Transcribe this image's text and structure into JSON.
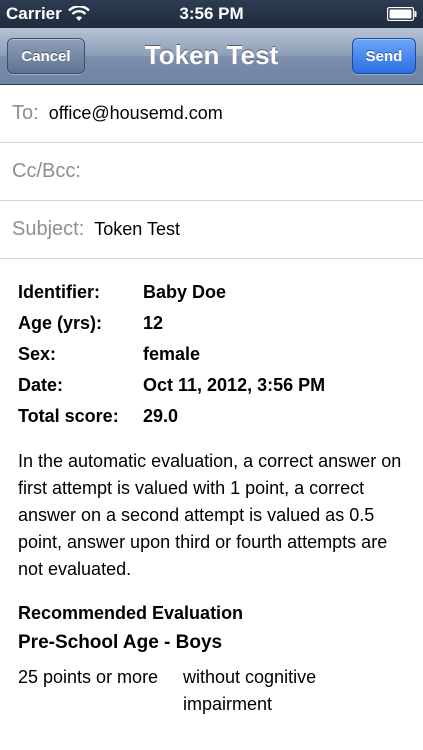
{
  "status_bar": {
    "carrier": "Carrier",
    "time": "3:56 PM",
    "icons": [
      "wifi-icon",
      "battery-icon"
    ]
  },
  "nav": {
    "title": "Token Test",
    "cancel_label": "Cancel",
    "send_label": "Send"
  },
  "fields": {
    "to_label": "To:",
    "to_value": "office@housemd.com",
    "cc_label": "Cc/Bcc:",
    "subject_label": "Subject:",
    "subject_value": "Token Test"
  },
  "info": [
    {
      "key": "Identifier:",
      "value": "Baby Doe"
    },
    {
      "key": "Age (yrs):",
      "value": "12"
    },
    {
      "key": "Sex:",
      "value": "female"
    },
    {
      "key": "Date:",
      "value": "Oct 11, 2012, 3:56 PM"
    },
    {
      "key": "Total score:",
      "value": "29.0"
    }
  ],
  "paragraph": "In the automatic evaluation, a correct answer on first attempt is valued with 1 point, a correct answer on a second attempt is valued as 0.5 point, answer upon third or fourth attempts are not evaluated.",
  "recommended_heading": "Recommended Evaluation",
  "group_heading": "Pre-School Age - Boys",
  "evaluation_rows": [
    {
      "points": "25 points or more",
      "result": "without cognitive impairment"
    }
  ],
  "colors": {
    "status_bar": "#1f2b3d",
    "nav_bar": "#8c9db7",
    "send_button": "#2a6fe4",
    "label_gray": "#8e8e93"
  }
}
